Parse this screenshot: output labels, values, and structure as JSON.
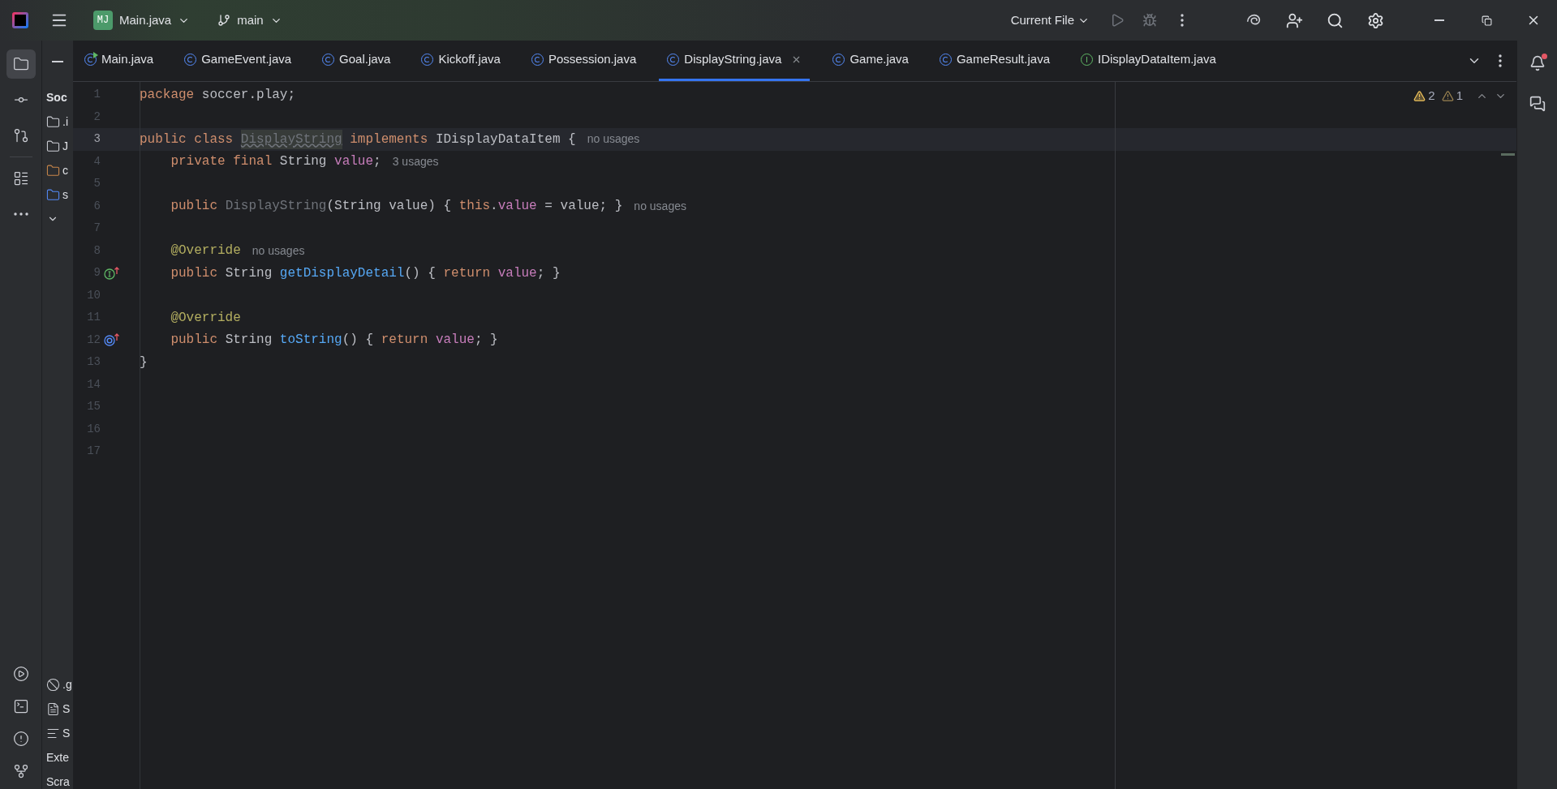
{
  "title_bar": {
    "project_badge": "MJ",
    "project": "Main.java",
    "branch": "main",
    "run_config": "Current File"
  },
  "tool_strip": {
    "top": [
      {
        "kind": "project",
        "selected": true
      },
      {
        "kind": "commit",
        "selected": false
      },
      {
        "kind": "pull_requests",
        "selected": false
      },
      {
        "kind": "structure",
        "selected": false
      },
      {
        "kind": "more",
        "selected": false
      }
    ],
    "bottom": [
      {
        "kind": "services",
        "selected": false
      },
      {
        "kind": "terminal",
        "selected": false
      },
      {
        "kind": "problems",
        "selected": false
      },
      {
        "kind": "git",
        "selected": false
      }
    ]
  },
  "project_panel": {
    "items": [
      {
        "kind": "root",
        "label": "Soc"
      },
      {
        "kind": "folder",
        "label": ".i"
      },
      {
        "kind": "folder",
        "label": "J"
      },
      {
        "kind": "excluded",
        "label": "c"
      },
      {
        "kind": "source",
        "label": "s"
      },
      {
        "kind": "chevron"
      },
      {
        "kind": "gitignore",
        "label": ".g"
      },
      {
        "kind": "file",
        "label": "S"
      },
      {
        "kind": "text",
        "label": "S"
      },
      {
        "kind": "plain",
        "label": "Exte"
      },
      {
        "kind": "plain",
        "label": "Scra"
      }
    ]
  },
  "tabs": [
    {
      "label": "Main.java",
      "kind": "main",
      "selected": false
    },
    {
      "label": "GameEvent.java",
      "kind": "class",
      "selected": false
    },
    {
      "label": "Goal.java",
      "kind": "class",
      "selected": false
    },
    {
      "label": "Kickoff.java",
      "kind": "class",
      "selected": false
    },
    {
      "label": "Possession.java",
      "kind": "class",
      "selected": false
    },
    {
      "label": "DisplayString.java",
      "kind": "class",
      "selected": true
    },
    {
      "label": "Game.java",
      "kind": "class",
      "selected": false
    },
    {
      "label": "GameResult.java",
      "kind": "class",
      "selected": false
    },
    {
      "label": "IDisplayDataItem.java",
      "kind": "interface",
      "selected": false
    }
  ],
  "inspections": {
    "warnings": "2",
    "weak_warnings": "1"
  },
  "lines": [
    {
      "number": "1",
      "current": false,
      "tokens": [
        {
          "text": "package ",
          "kind": "keyword"
        },
        {
          "text": "soccer.play;",
          "kind": "plain"
        }
      ]
    },
    {
      "number": "2",
      "current": false
    },
    {
      "number": "3",
      "current": true,
      "tokens": [
        {
          "text": "public class ",
          "kind": "keyword"
        },
        {
          "text": "DisplayString",
          "kind": "unused_decl"
        },
        {
          "text": " implements ",
          "kind": "keyword"
        },
        {
          "text": "IDisplayDataItem {",
          "kind": "plain"
        },
        {
          "text": "no usages",
          "kind": "hint"
        }
      ]
    },
    {
      "number": "4",
      "current": false,
      "tokens": [
        {
          "text": "    private final ",
          "kind": "keyword"
        },
        {
          "text": "String ",
          "kind": "plain"
        },
        {
          "text": "value",
          "kind": "field"
        },
        {
          "text": ";",
          "kind": "plain"
        },
        {
          "text": "3 usages",
          "kind": "hint"
        }
      ]
    },
    {
      "number": "5",
      "current": false
    },
    {
      "number": "6",
      "current": false,
      "tokens": [
        {
          "text": "    public ",
          "kind": "keyword"
        },
        {
          "text": "DisplayString",
          "kind": "unused"
        },
        {
          "text": "(String value) { ",
          "kind": "plain"
        },
        {
          "text": "this",
          "kind": "keyword"
        },
        {
          "text": ".",
          "kind": "plain"
        },
        {
          "text": "value",
          "kind": "field"
        },
        {
          "text": " = value; }",
          "kind": "plain"
        },
        {
          "text": "no usages",
          "kind": "hint"
        }
      ]
    },
    {
      "number": "7",
      "current": false
    },
    {
      "number": "8",
      "current": false,
      "tokens": [
        {
          "text": "    @Override",
          "kind": "annotation"
        },
        {
          "text": "no usages",
          "kind": "hint"
        }
      ]
    },
    {
      "number": "9",
      "current": false,
      "kind": "implements",
      "tokens": [
        {
          "text": "    public ",
          "kind": "keyword"
        },
        {
          "text": "String ",
          "kind": "plain"
        },
        {
          "text": "getDisplayDetail",
          "kind": "method"
        },
        {
          "text": "() { ",
          "kind": "plain"
        },
        {
          "text": "return ",
          "kind": "keyword"
        },
        {
          "text": "value",
          "kind": "field"
        },
        {
          "text": "; }",
          "kind": "plain"
        }
      ]
    },
    {
      "number": "10",
      "current": false
    },
    {
      "number": "11",
      "current": false,
      "tokens": [
        {
          "text": "    @Override",
          "kind": "annotation"
        }
      ]
    },
    {
      "number": "12",
      "current": false,
      "kind": "overrides",
      "tokens": [
        {
          "text": "    public ",
          "kind": "keyword"
        },
        {
          "text": "String ",
          "kind": "plain"
        },
        {
          "text": "toString",
          "kind": "method"
        },
        {
          "text": "() { ",
          "kind": "plain"
        },
        {
          "text": "return ",
          "kind": "keyword"
        },
        {
          "text": "value",
          "kind": "field"
        },
        {
          "text": "; }",
          "kind": "plain"
        }
      ]
    },
    {
      "number": "13",
      "current": false,
      "tokens": [
        {
          "text": "}",
          "kind": "plain"
        }
      ]
    },
    {
      "number": "14",
      "current": false
    },
    {
      "number": "15",
      "current": false
    },
    {
      "number": "16",
      "current": false
    },
    {
      "number": "17",
      "current": false
    }
  ]
}
